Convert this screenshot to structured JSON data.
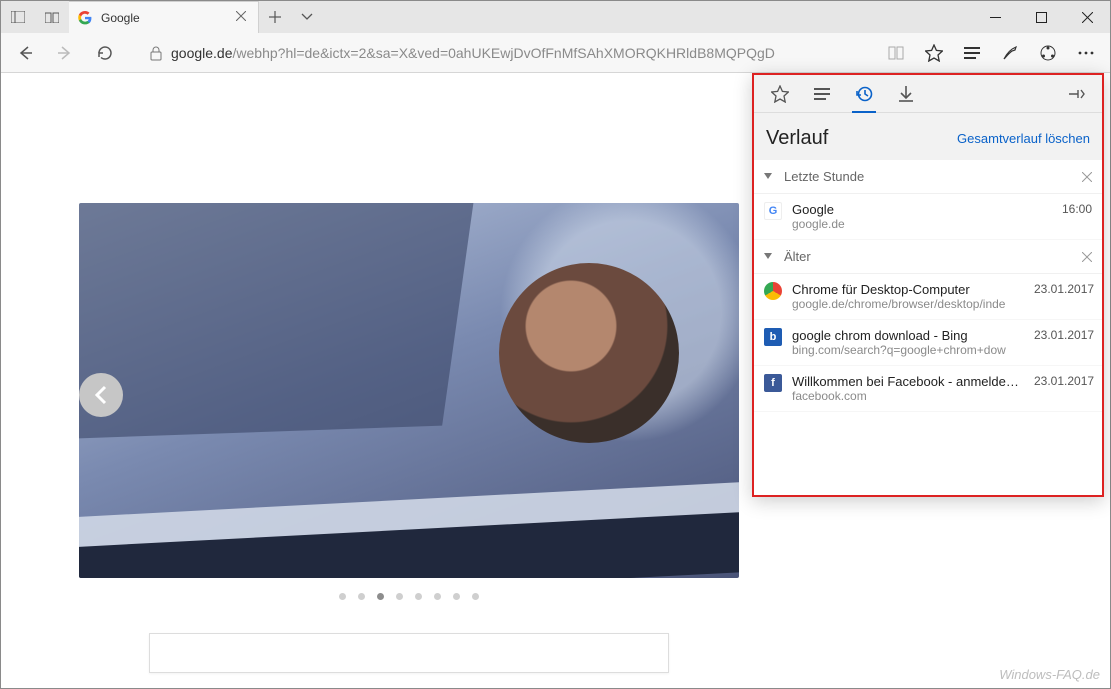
{
  "window": {
    "tab_title": "Google",
    "url_host": "google.de",
    "url_path": "/webhp?hl=de&ictx=2&sa=X&ved=0ahUKEwjDvOfFnMfSAhXMORQKHRldB8MQPQgD"
  },
  "carousel": {
    "total_dots": 8,
    "active_index": 2
  },
  "hub": {
    "title": "Verlauf",
    "clear_label": "Gesamtverlauf löschen",
    "sections": [
      {
        "title": "Letzte Stunde",
        "items": [
          {
            "icon": "google",
            "title": "Google",
            "subtitle": "google.de",
            "when": "16:00"
          }
        ]
      },
      {
        "title": "Älter",
        "items": [
          {
            "icon": "chrome",
            "title": "Chrome für Desktop-Computer",
            "subtitle": "google.de/chrome/browser/desktop/inde",
            "when": "23.01.2017"
          },
          {
            "icon": "bing",
            "title": "google chrom download - Bing",
            "subtitle": "bing.com/search?q=google+chrom+dow",
            "when": "23.01.2017"
          },
          {
            "icon": "fb",
            "title": "Willkommen bei Facebook - anmelden, re",
            "subtitle": "facebook.com",
            "when": "23.01.2017"
          }
        ]
      }
    ]
  },
  "watermark": "Windows-FAQ.de"
}
